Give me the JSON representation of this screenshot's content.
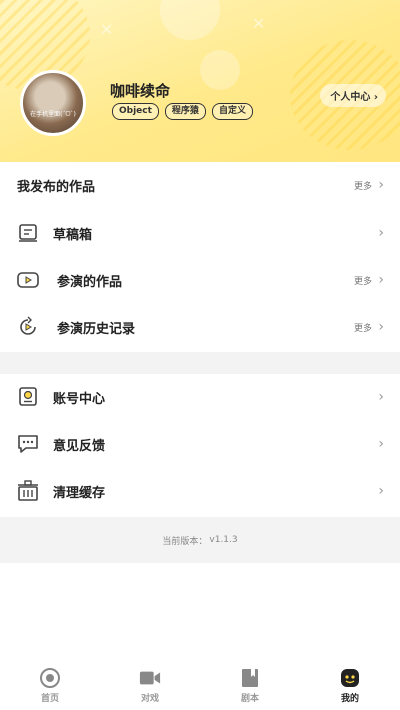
{
  "header": {
    "username": "咖啡续命",
    "tags": [
      "Object",
      "程序猿",
      "自定义"
    ],
    "profile_center_label": "个人中心",
    "avatar_caption": "在手机里面(ˊᗜˋ)"
  },
  "works_section": {
    "published": {
      "label": "我发布的作品",
      "more": "更多"
    },
    "drafts": {
      "label": "草稿箱"
    },
    "acted": {
      "label": "参演的作品",
      "more": "更多"
    },
    "history": {
      "label": "参演历史记录",
      "more": "更多"
    }
  },
  "settings_section": {
    "account": {
      "label": "账号中心"
    },
    "feedback": {
      "label": "意见反馈"
    },
    "cache": {
      "label": "清理缓存"
    }
  },
  "version": {
    "prefix": "当前版本：",
    "value": "v1.1.3"
  },
  "tabbar": {
    "home": "首页",
    "battle": "对戏",
    "script": "剧本",
    "mine": "我的"
  },
  "colors": {
    "accent": "#ffe680",
    "icon": "#444444"
  }
}
